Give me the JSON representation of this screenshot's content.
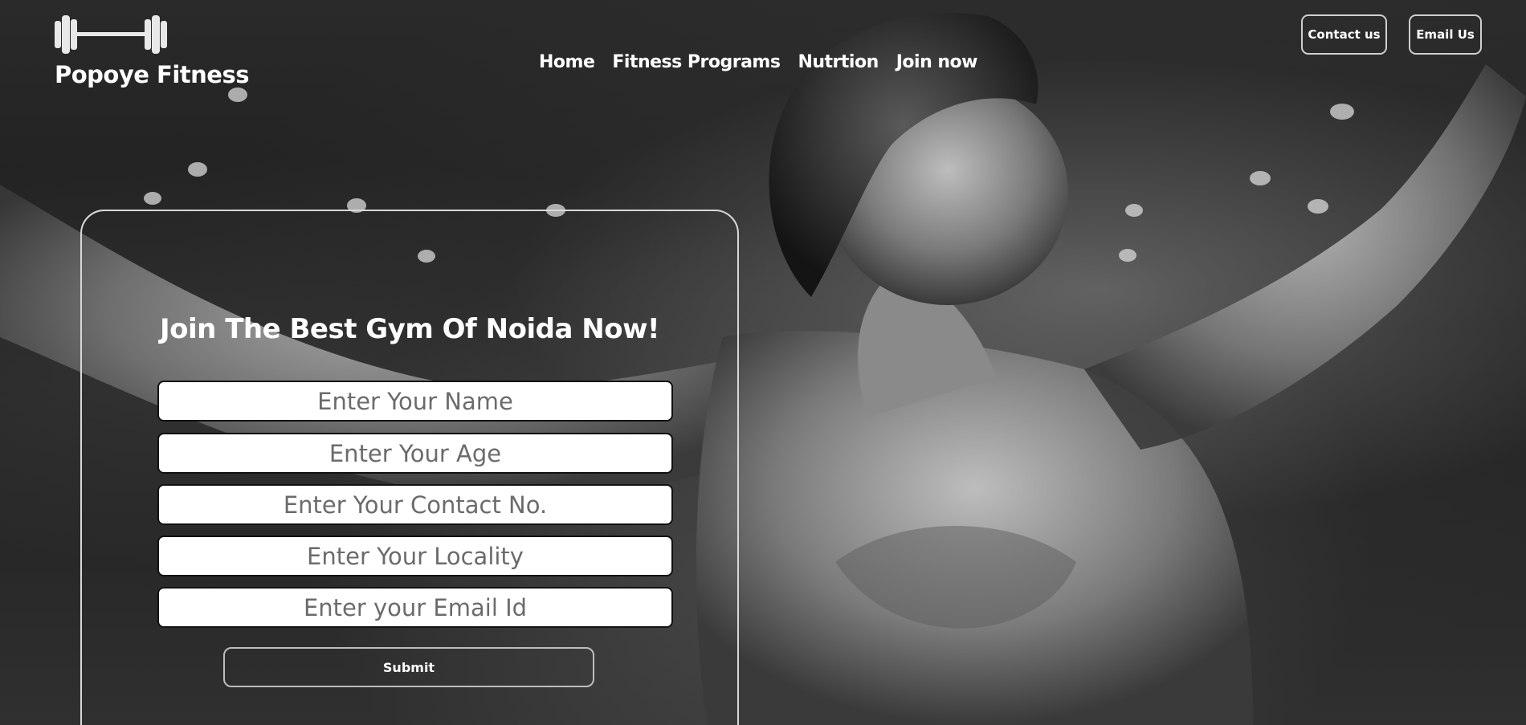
{
  "brand": {
    "name": "Popoye Fitness",
    "logo_icon": "dumbbell-icon"
  },
  "nav": {
    "items": [
      "Home",
      "Fitness Programs",
      "Nutrtion",
      "Join now"
    ]
  },
  "top_buttons": {
    "contact": "Contact us",
    "email": "Email Us"
  },
  "form": {
    "title": "Join The Best Gym Of Noida Now!",
    "fields": {
      "name_placeholder": "Enter Your Name",
      "age_placeholder": "Enter Your Age",
      "contact_placeholder": "Enter Your Contact No.",
      "locality_placeholder": "Enter Your Locality",
      "email_placeholder": "Enter your Email Id"
    },
    "submit_label": "Submit"
  },
  "colors": {
    "text": "#ffffff",
    "field_bg": "#ffffff",
    "border": "#d8d8d8"
  }
}
